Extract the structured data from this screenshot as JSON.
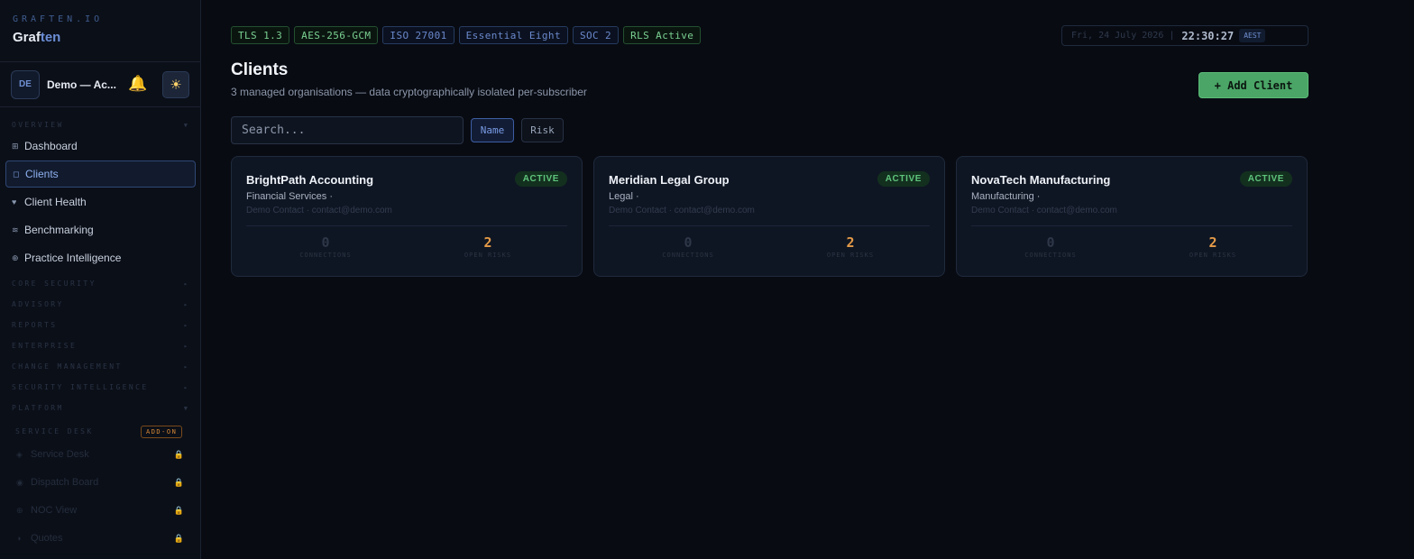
{
  "brand": {
    "kicker": "GRAFTEN.IO",
    "name_main": "Graf",
    "name_accent": "ten"
  },
  "account": {
    "initials": "DE",
    "name": "Demo — Ac..."
  },
  "sidebar": {
    "sections": {
      "overview": "OVERVIEW",
      "core_security": "CORE SECURITY",
      "advisory": "ADVISORY",
      "reports": "REPORTS",
      "enterprise": "ENTERPRISE",
      "change_management": "CHANGE MANAGEMENT",
      "security_intelligence": "SECURITY INTELLIGENCE",
      "platform": "PLATFORM",
      "service_desk": "SERVICE DESK"
    },
    "items": [
      {
        "label": "Dashboard",
        "icon": "⊞"
      },
      {
        "label": "Clients",
        "icon": "◻"
      },
      {
        "label": "Client Health",
        "icon": "♥"
      },
      {
        "label": "Benchmarking",
        "icon": "≋"
      },
      {
        "label": "Practice Intelligence",
        "icon": "⊕"
      }
    ],
    "addon_label": "ADD-ON",
    "locked_items": [
      {
        "label": "Service Desk",
        "icon": "◈"
      },
      {
        "label": "Dispatch Board",
        "icon": "◉"
      },
      {
        "label": "NOC View",
        "icon": "⊕"
      },
      {
        "label": "Quotes",
        "icon": "◑"
      }
    ]
  },
  "badges": [
    {
      "label": "TLS 1.3",
      "tone": "green"
    },
    {
      "label": "AES-256-GCM",
      "tone": "green"
    },
    {
      "label": "ISO 27001",
      "tone": "blue"
    },
    {
      "label": "Essential Eight",
      "tone": "blue"
    },
    {
      "label": "SOC 2",
      "tone": "blue"
    },
    {
      "label": "RLS Active",
      "tone": "green"
    }
  ],
  "clock": {
    "date": "Fri, 24 July 2026",
    "separator": "|",
    "time": "22:30:27",
    "timezone": "AEST"
  },
  "page": {
    "title": "Clients",
    "subtitle": "3 managed organisations — data cryptographically isolated per-subscriber",
    "add_button": "+ Add Client"
  },
  "search": {
    "placeholder": "Search..."
  },
  "sort": {
    "name": "Name",
    "risk": "Risk"
  },
  "cards": [
    {
      "name": "BrightPath Accounting",
      "status": "ACTIVE",
      "industry": "Financial Services ·",
      "contact": "Demo Contact · contact@demo.com",
      "connections": "0",
      "connections_label": "CONNECTIONS",
      "open_risks": "2",
      "open_risks_label": "OPEN RISKS"
    },
    {
      "name": "Meridian Legal Group",
      "status": "ACTIVE",
      "industry": "Legal ·",
      "contact": "Demo Contact · contact@demo.com",
      "connections": "0",
      "connections_label": "CONNECTIONS",
      "open_risks": "2",
      "open_risks_label": "OPEN RISKS"
    },
    {
      "name": "NovaTech Manufacturing",
      "status": "ACTIVE",
      "industry": "Manufacturing ·",
      "contact": "Demo Contact · contact@demo.com",
      "connections": "0",
      "connections_label": "CONNECTIONS",
      "open_risks": "2",
      "open_risks_label": "OPEN RISKS"
    }
  ],
  "colors": {
    "accent": "#6b8ed6",
    "success": "#4aa566",
    "risk": "#e49a48",
    "background": "#080b12"
  }
}
